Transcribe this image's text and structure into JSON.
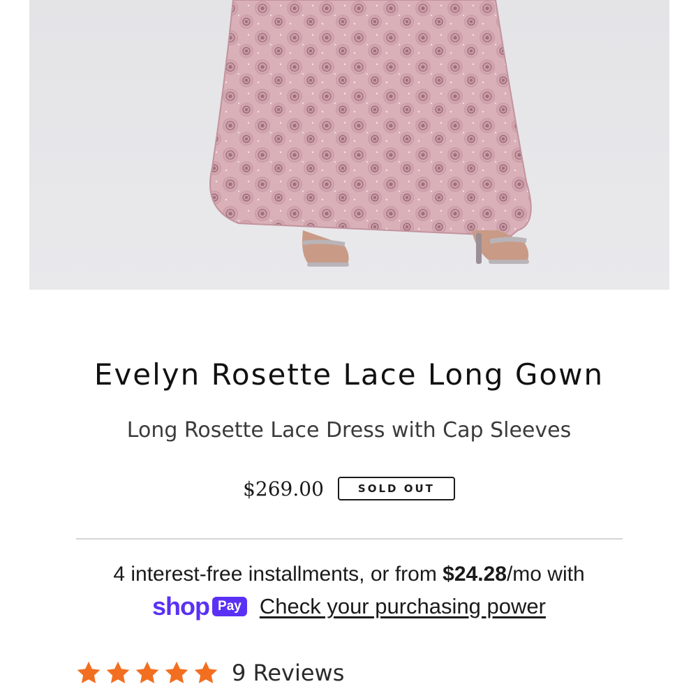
{
  "product": {
    "image_alt": "Evelyn Rosette Lace Long Gown",
    "title": "Evelyn Rosette Lace Long Gown",
    "subtitle": "Long Rosette Lace Dress with Cap Sleeves",
    "price": "$269.00",
    "badge": "SOLD OUT"
  },
  "financing": {
    "prefix": "4 interest-free installments, or from ",
    "amount": "$24.28",
    "suffix": "/mo with",
    "shop_word": "shop",
    "pay_word": "Pay",
    "link": "Check your purchasing power",
    "brand_color": "#5a31f4"
  },
  "reviews": {
    "rating": 5,
    "max": 5,
    "star_icon": "star-icon",
    "star_color": "#f26f21",
    "label": "9 Reviews"
  }
}
